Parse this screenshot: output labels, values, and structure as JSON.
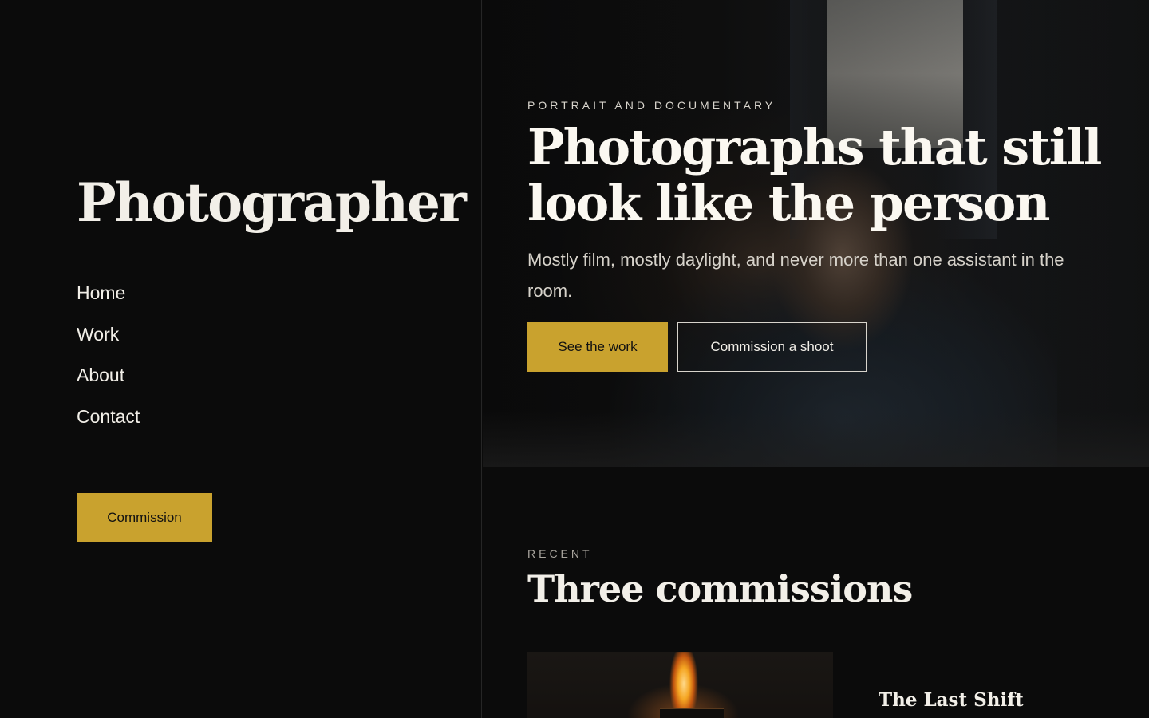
{
  "sidebar": {
    "brand": "Photographer",
    "nav": [
      {
        "label": "Home"
      },
      {
        "label": "Work"
      },
      {
        "label": "About"
      },
      {
        "label": "Contact"
      }
    ],
    "cta_label": "Commission"
  },
  "hero": {
    "eyebrow": "PORTRAIT AND DOCUMENTARY",
    "title": "Photographs that still look like the person",
    "subtitle": "Mostly film, mostly daylight, and never more than one assistant in the room.",
    "primary_button": "See the work",
    "secondary_button": "Commission a shoot"
  },
  "recent": {
    "eyebrow": "RECENT",
    "title": "Three commissions",
    "cards": [
      {
        "title": "The Last Shift"
      }
    ]
  },
  "colors": {
    "accent": "#c9a22e",
    "background": "#0b0b0b",
    "text": "#f2efe8"
  }
}
